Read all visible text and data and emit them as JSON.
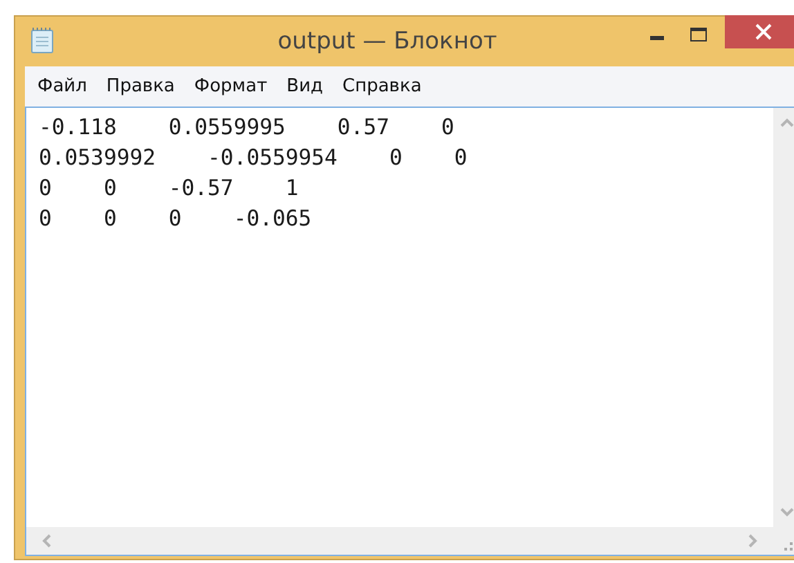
{
  "window": {
    "title": "output — Блокнот"
  },
  "menu": [
    "Файл",
    "Правка",
    "Формат",
    "Вид",
    "Справка"
  ],
  "document": {
    "lines": [
      "-0.118    0.0559995    0.57    0",
      "0.0539992    -0.0559954    0    0",
      "0    0    -0.57    1",
      "0    0    0    -0.065"
    ]
  }
}
